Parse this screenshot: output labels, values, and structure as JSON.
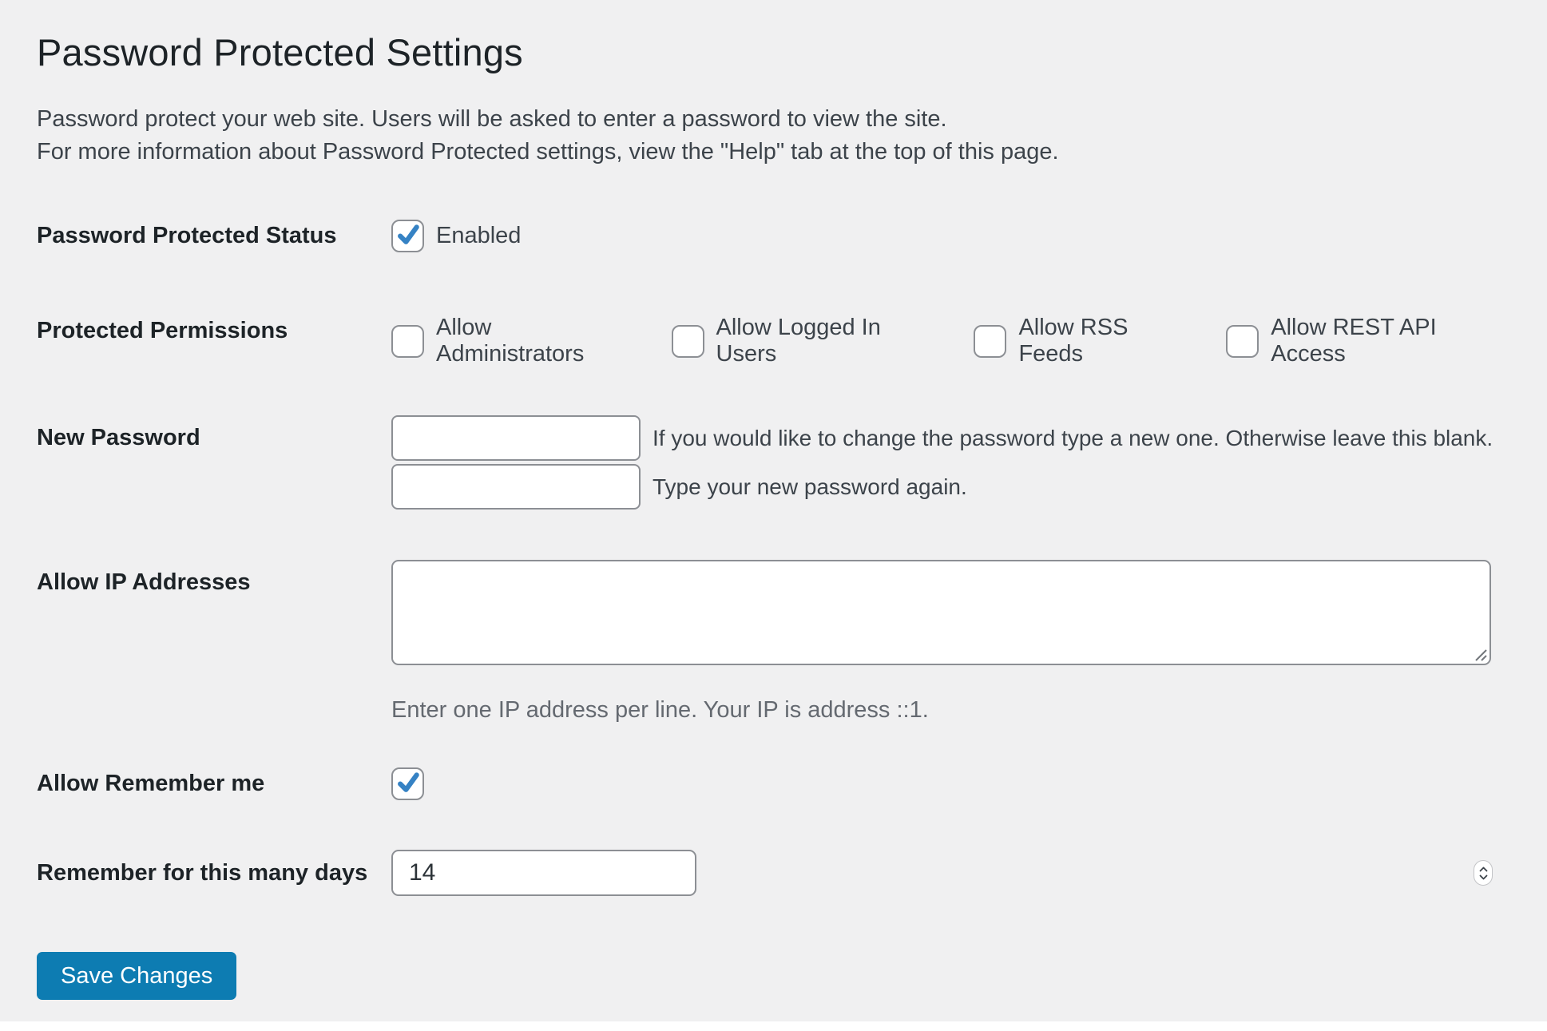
{
  "page": {
    "title": "Password Protected Settings",
    "intro_line1": "Password protect your web site. Users will be asked to enter a password to view the site.",
    "intro_line2": "For more information about Password Protected settings, view the \"Help\" tab at the top of this page."
  },
  "form": {
    "status": {
      "label": "Password Protected Status",
      "option_label": "Enabled",
      "checked": true
    },
    "permissions": {
      "label": "Protected Permissions",
      "options": [
        {
          "label": "Allow Administrators",
          "checked": false
        },
        {
          "label": "Allow Logged In Users",
          "checked": false
        },
        {
          "label": "Allow RSS Feeds",
          "checked": false
        },
        {
          "label": "Allow REST API Access",
          "checked": false
        }
      ]
    },
    "new_password": {
      "label": "New Password",
      "field1_value": "",
      "field2_value": "",
      "help1": "If you would like to change the password type a new one. Otherwise leave this blank.",
      "help2": "Type your new password again."
    },
    "allow_ip": {
      "label": "Allow IP Addresses",
      "value": "",
      "description": "Enter one IP address per line. Your IP is address ::1."
    },
    "remember_me": {
      "label": "Allow Remember me",
      "checked": true
    },
    "remember_days": {
      "label": "Remember for this many days",
      "value": "14"
    }
  },
  "actions": {
    "save_label": "Save Changes"
  },
  "colors": {
    "background": "#f0f0f1",
    "checkmark_blue": "#3582c4",
    "button_blue": "#0d7cb2",
    "input_border": "#8c8f94",
    "heading_text": "#1d2327",
    "body_text": "#3c434a",
    "muted_text": "#646970"
  }
}
